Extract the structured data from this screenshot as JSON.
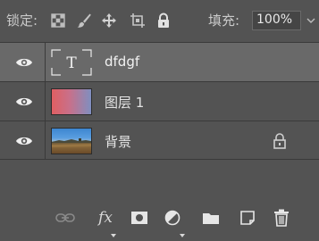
{
  "lockbar": {
    "lock_label": "锁定:",
    "fill_label": "填充:",
    "fill_value": "100%"
  },
  "layers": [
    {
      "name": "dfdgf",
      "type": "text",
      "visible": true,
      "selected": true,
      "locked": false,
      "thumb_glyph": "T"
    },
    {
      "name": "图层 1",
      "type": "gradient",
      "visible": true,
      "selected": false,
      "locked": false
    },
    {
      "name": "背景",
      "type": "photo",
      "visible": true,
      "selected": false,
      "locked": true
    }
  ],
  "bottom_toolbar": {
    "icons": [
      "link-icon",
      "fx-icon",
      "mask-icon",
      "adjustment-icon",
      "folder-icon",
      "new-layer-icon",
      "trash-icon"
    ],
    "fx_label": "fx"
  },
  "colors": {
    "panel_bg": "#535353",
    "selected_row": "#696969",
    "separator": "#3a3a3a",
    "text": "#e4e4e4"
  }
}
